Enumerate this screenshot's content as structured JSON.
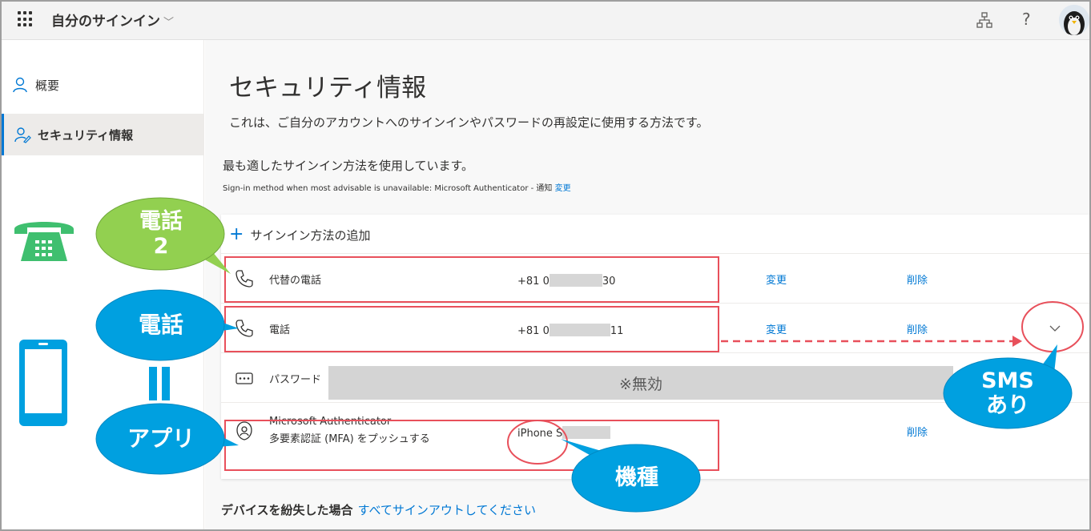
{
  "header": {
    "app_title": "自分のサインイン",
    "icons": [
      "waffle-icon",
      "org-icon",
      "help-icon",
      "avatar"
    ],
    "help_glyph": "?"
  },
  "sidebar": {
    "items": [
      {
        "label": "概要",
        "icon": "person-icon"
      },
      {
        "label": "セキュリティ情報",
        "icon": "security-person-icon",
        "selected": true
      }
    ]
  },
  "main": {
    "title": "セキュリティ情報",
    "description": "これは、ご自分のアカウントへのサインインやパスワードの再設定に使用する方法です。",
    "best_method": "最も適したサインイン方法を使用しています。",
    "fallback_text": "Sign-in method when most advisable is unavailable: Microsoft Authenticator - 通知",
    "fallback_link": "変更",
    "add_method": "サインイン方法の追加",
    "methods": [
      {
        "name": "代替の電話",
        "value_prefix": "+81 0",
        "value_suffix": "30",
        "change": "変更",
        "delete": "削除"
      },
      {
        "name": "電話",
        "value_prefix": "+81 0",
        "value_suffix": "11",
        "change": "変更",
        "delete": "削除"
      },
      {
        "name": "パスワード",
        "overlay": "※無効"
      },
      {
        "name_line1": "Microsoft Authenticator",
        "name_line2": "多要素認証 (MFA) をプッシュする",
        "value_prefix": "iPhone S",
        "delete": "削除"
      }
    ],
    "lost_device_label": "デバイスを紛失した場合",
    "lost_device_link": "すべてサインアウトしてください"
  },
  "annotations": {
    "phone2": "電話\n2",
    "phone": "電話",
    "app": "アプリ",
    "model": "機種",
    "sms": "SMS\nあり",
    "colors": {
      "green": "#92d050",
      "blue": "#00a0e0",
      "red": "#e8505b"
    }
  }
}
